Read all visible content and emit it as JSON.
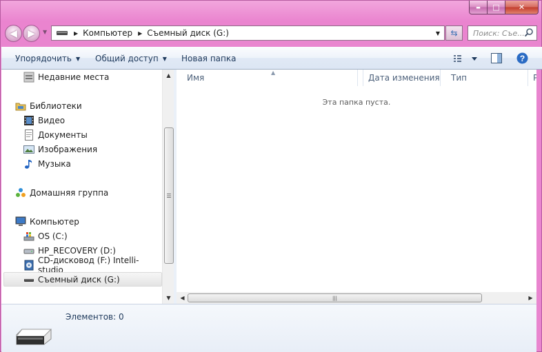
{
  "window": {
    "caption_buttons": {
      "minimize": "▬",
      "maximize": "□",
      "close": "✕"
    }
  },
  "nav": {
    "back_icon": "back-arrow-icon",
    "forward_icon": "forward-arrow-icon",
    "breadcrumb": [
      "Компьютер",
      "Съемный диск (G:)"
    ],
    "search_placeholder": "Поиск: Съе..."
  },
  "toolbar": {
    "organize": "Упорядочить",
    "share": "Общий доступ",
    "new_folder": "Новая папка"
  },
  "sidebar": {
    "items": [
      {
        "label": "Недавние места",
        "icon": "recent-places-icon"
      },
      {
        "label": "Библиотеки",
        "icon": "libraries-icon"
      },
      {
        "label": "Видео",
        "icon": "video-icon"
      },
      {
        "label": "Документы",
        "icon": "documents-icon"
      },
      {
        "label": "Изображения",
        "icon": "pictures-icon"
      },
      {
        "label": "Музыка",
        "icon": "music-icon"
      },
      {
        "label": "Домашняя группа",
        "icon": "homegroup-icon"
      },
      {
        "label": "Компьютер",
        "icon": "computer-icon"
      },
      {
        "label": "OS (C:)",
        "icon": "os-drive-icon"
      },
      {
        "label": "HP_RECOVERY (D:)",
        "icon": "hard-drive-icon"
      },
      {
        "label": "CD-дисковод (F:) Intelli-studio",
        "icon": "cd-drive-icon"
      },
      {
        "label": "Съемный диск (G:)",
        "icon": "removable-drive-icon",
        "selected": true
      }
    ]
  },
  "content": {
    "columns": [
      "Имя",
      "Дата изменения",
      "Тип",
      "Р"
    ],
    "empty_message": "Эта папка пуста."
  },
  "details": {
    "item_count": "Элементов: 0"
  },
  "colors": {
    "frame": "#ea84cf",
    "toolbar_text": "#1e395b",
    "header_text": "#4c607a"
  }
}
